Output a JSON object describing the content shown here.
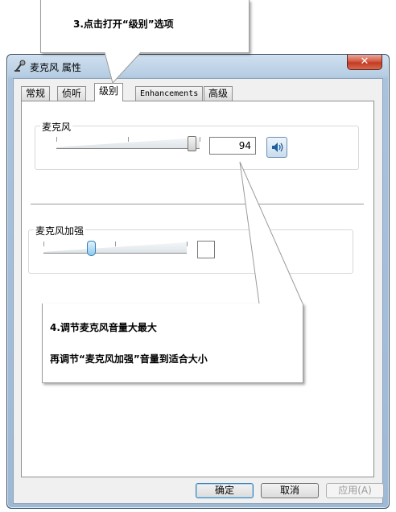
{
  "window": {
    "title": "麦克风 属性",
    "close_label": "✕",
    "icon": "microphone-icon"
  },
  "tabs": [
    {
      "label": "常规"
    },
    {
      "label": "侦听"
    },
    {
      "label": "级别",
      "active": true
    },
    {
      "label": "Enhancements"
    },
    {
      "label": "高级"
    }
  ],
  "levels": {
    "mic": {
      "label": "麦克风",
      "value": "94",
      "level": 0.94,
      "speaker_icon": "speaker-icon"
    },
    "boost": {
      "label": "麦克风加强",
      "value": "",
      "level": 0.35
    }
  },
  "buttons": {
    "ok": "确定",
    "cancel": "取消",
    "apply": "应用(A)"
  },
  "callouts": {
    "step3": "3.点击打开“级别”选项",
    "step4_line1": "4.调节麦克风音量大最大",
    "step4_line2": "再调节“麦克风加强”音量到适合大小"
  }
}
